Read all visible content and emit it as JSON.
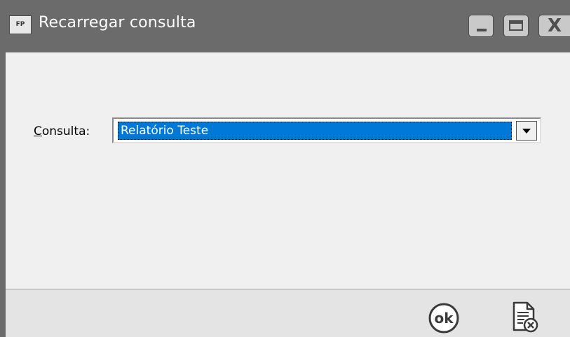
{
  "window": {
    "app_icon_text": "FP",
    "title": "Recarregar consulta"
  },
  "form": {
    "consulta_label_underlined": "C",
    "consulta_label_rest": "onsulta:",
    "consulta_value": "Relatório Teste"
  },
  "footer": {
    "ok_label": "ok"
  },
  "icons": {
    "app": "fp-app-icon",
    "minimize": "minimize-icon",
    "maximize": "maximize-icon",
    "close": "close-icon",
    "dropdown": "chevron-down-icon",
    "ok": "ok-circle-icon",
    "cancel": "document-cancel-icon"
  }
}
